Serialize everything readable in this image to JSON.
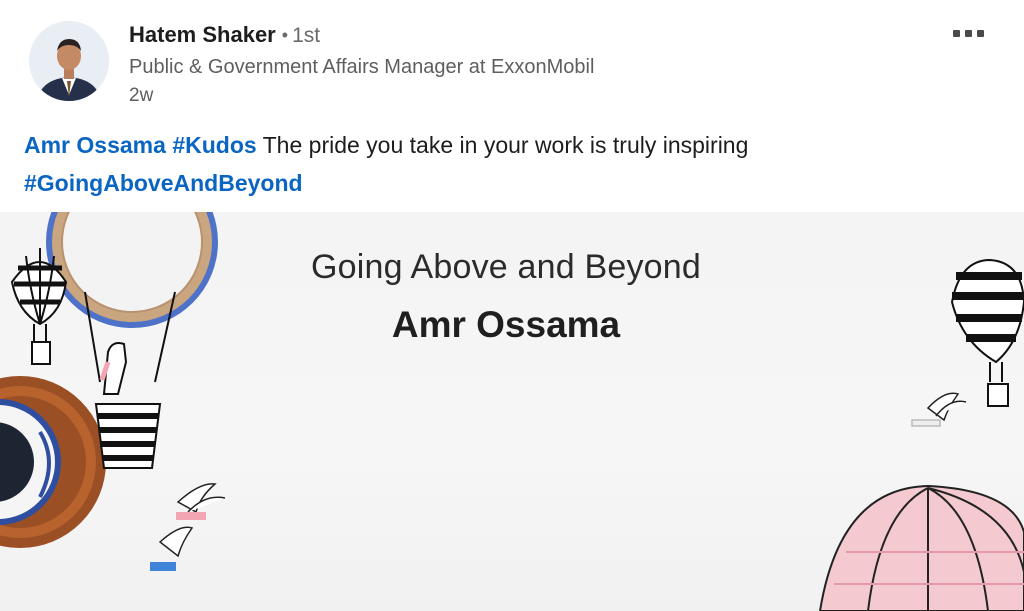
{
  "post": {
    "author": {
      "name": "Hatem Shaker",
      "degree_separator": "•",
      "degree": "1st",
      "headline": "Public & Government Affairs Manager at ExxonMobil",
      "time": "2w"
    },
    "menu_icon": "more-horizontal-icon",
    "text": {
      "mention": "Amr Ossama",
      "hashtag1": "#Kudos",
      "message": " The pride you take in your work is truly inspiring",
      "hashtag2": "#GoingAboveAndBeyond"
    },
    "image": {
      "title": "Going Above and Beyond",
      "name": "Amr Ossama"
    }
  },
  "colors": {
    "link": "#0a66c2",
    "text": "#1d1d1d",
    "secondary": "#5e5e5e"
  }
}
